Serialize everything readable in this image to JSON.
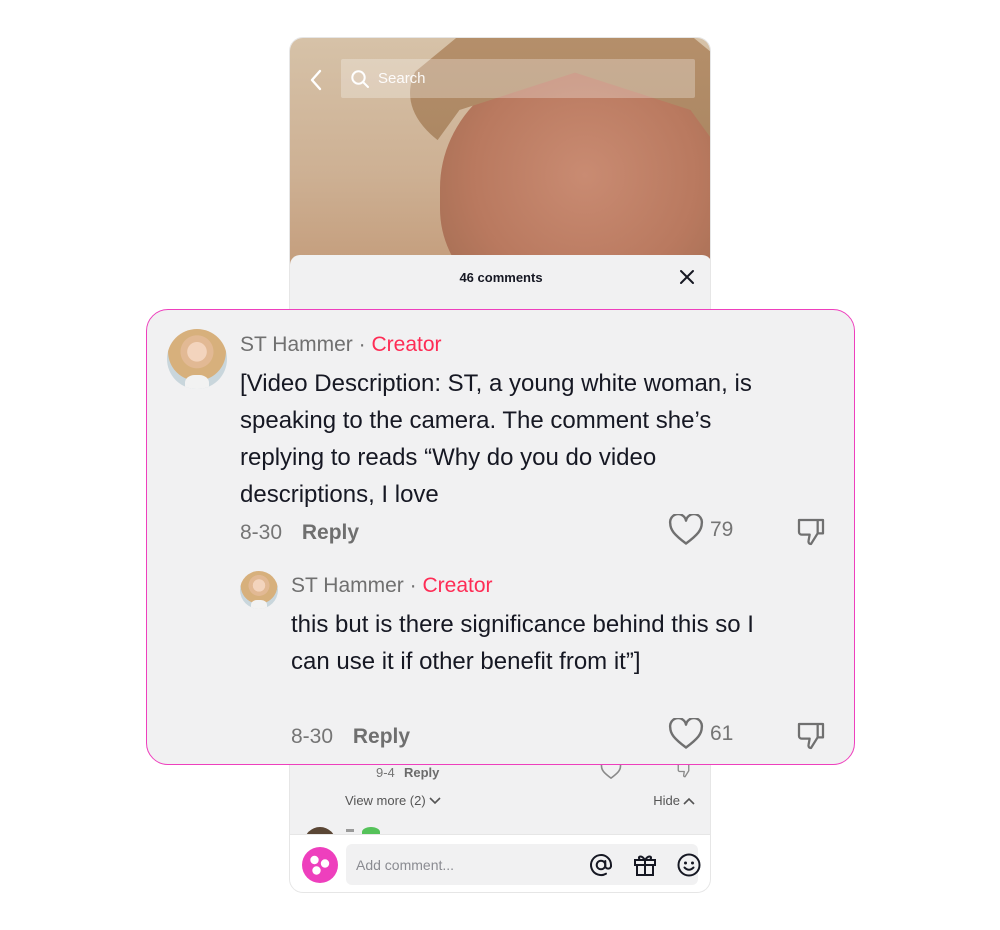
{
  "search": {
    "placeholder": "Search"
  },
  "sheet": {
    "title": "46 comments"
  },
  "highlight": {
    "comment": {
      "author": "ST Hammer",
      "separator": "·",
      "badge": "Creator",
      "text": "[Video Description: ST, a young white woman, is speaking to the camera. The comment she’s replying to reads “Why do you do video descriptions, I love",
      "date": "8-30",
      "reply_label": "Reply",
      "likes": "79"
    },
    "reply": {
      "author": "ST Hammer",
      "separator": "·",
      "badge": "Creator",
      "text": "this but is there significance behind this so I can use it if other benefit from it”]",
      "date": "8-30",
      "reply_label": "Reply",
      "likes": "61"
    }
  },
  "below": {
    "reply_row": {
      "date": "9-4",
      "reply_label": "Reply"
    },
    "view_more": "View more (2)",
    "hide": "Hide"
  },
  "composer": {
    "placeholder": "Add comment..."
  },
  "colors": {
    "accent": "#fe2c55",
    "highlight_border": "#ee3fbd",
    "avatar_pink": "#ee3fbd"
  },
  "icons": [
    "back-arrow-icon",
    "search-icon",
    "close-icon",
    "heart-icon",
    "dislike-icon",
    "chevron-down-icon",
    "chevron-up-icon",
    "at-icon",
    "gift-icon",
    "emoji-icon"
  ]
}
